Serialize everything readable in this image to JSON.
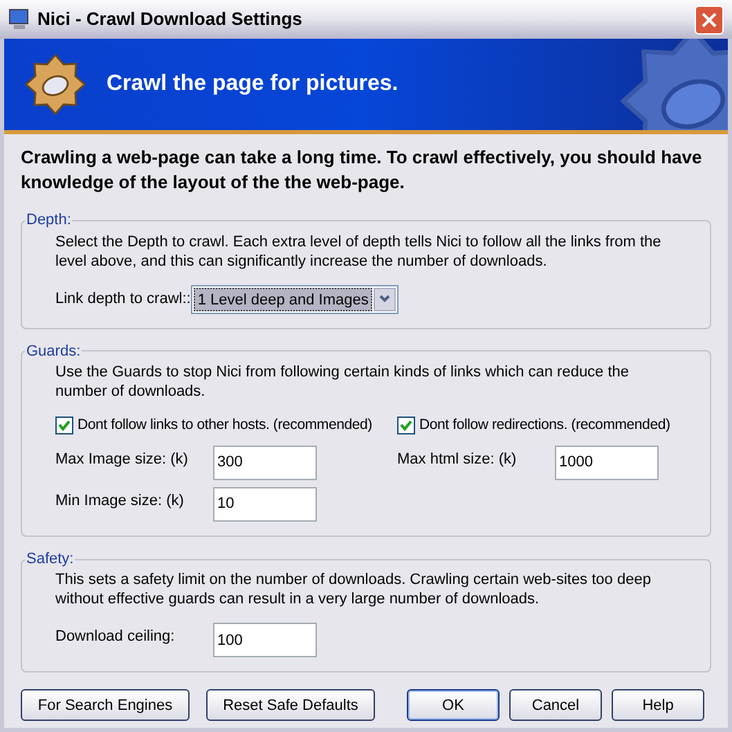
{
  "window": {
    "title": "Nici - Crawl Download Settings"
  },
  "banner": {
    "heading": "Crawl the page for pictures."
  },
  "intro": "Crawling a web-page can take a long time. To crawl effectively, you should have knowledge of the layout of the the web-page.",
  "groups": [
    {
      "title": "Depth:",
      "description": "Select the Depth to crawl. Each extra level of depth tells Nici to follow all the links from the level above, and this can significantly increase the number of downloads.",
      "fields": [
        {
          "kind": "dropdown",
          "label": "Link depth to crawl::",
          "value": "1 Level deep and Images"
        }
      ]
    },
    {
      "title": "Guards:",
      "description": "Use the Guards to stop Nici from following certain kinds of links which can reduce the number of downloads.",
      "checkboxes": [
        {
          "label": "Dont follow links to other hosts. (recommended)",
          "checked": true
        },
        {
          "label": "Dont follow redirections. (recommended)",
          "checked": true
        }
      ],
      "fields": [
        {
          "kind": "text",
          "label": "Max Image size: (k)",
          "value": "300"
        },
        {
          "kind": "text",
          "label": "Max html size: (k)",
          "value": "1000"
        },
        {
          "kind": "text",
          "label": "Min Image size: (k)",
          "value": "10"
        }
      ]
    },
    {
      "title": "Safety:",
      "description": "This sets a safety limit on the number of downloads. Crawling certain web-sites too deep without effective guards can result in a very large number of downloads.",
      "fields": [
        {
          "kind": "text",
          "label": "Download ceiling:",
          "value": "100"
        }
      ]
    }
  ],
  "buttons_left": [
    "For Search Engines",
    "Reset Safe Defaults"
  ],
  "buttons_right": [
    {
      "label": "OK",
      "default": true
    },
    {
      "label": "Cancel",
      "default": false
    },
    {
      "label": "Help",
      "default": false
    }
  ]
}
